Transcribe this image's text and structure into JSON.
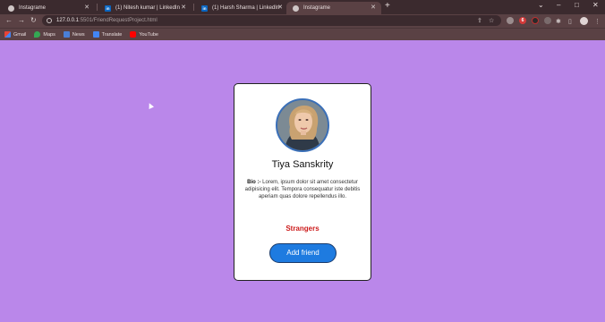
{
  "browser": {
    "tabs": [
      {
        "title": "Instagrame",
        "icon": "globe-icon"
      },
      {
        "title": "(1) Nitesh kumar | LinkedIn",
        "icon": "linkedin-icon"
      },
      {
        "title": "(1) Harsh Sharma | LinkedIn",
        "icon": "linkedin-icon"
      },
      {
        "title": "Instagrame",
        "icon": "globe-icon",
        "active": true
      }
    ],
    "url": {
      "host": "127.0.0.1",
      "path": ":5501/FriendRequestProject.html"
    },
    "bookmarks": [
      {
        "label": "Gmail",
        "icon": "gmail-icon"
      },
      {
        "label": "Maps",
        "icon": "maps-icon"
      },
      {
        "label": "News",
        "icon": "news-icon"
      },
      {
        "label": "Translate",
        "icon": "translate-icon"
      },
      {
        "label": "YouTube",
        "icon": "youtube-icon"
      }
    ]
  },
  "profile": {
    "name": "Tiya Sanskrity",
    "bio_label": "Bio :-",
    "bio_text": "Lorem, ipsum dolor sit amet consectetur adipisicing elit. Tempora consequatur iste debitis aperiam quas dolore repellendus illo.",
    "status": "Strangers",
    "button_label": "Add friend"
  },
  "colors": {
    "page_background": "#ba87ea",
    "status_red": "#cc1b1b",
    "button_blue": "#1e7be0"
  }
}
